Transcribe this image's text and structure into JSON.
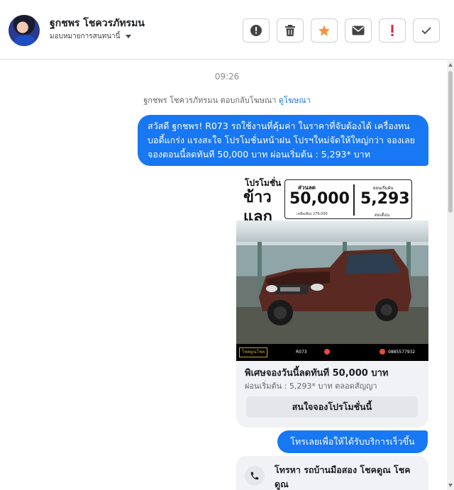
{
  "header": {
    "contact_name": "ฐกชพร โชควรภัทรมน",
    "assign_label": "มอบหมายการสนทนานี้",
    "actions": [
      {
        "name": "spam-button",
        "icon": "exclamation-circle-icon"
      },
      {
        "name": "delete-button",
        "icon": "trash-icon"
      },
      {
        "name": "star-button",
        "icon": "star-icon",
        "color": "#f7923a"
      },
      {
        "name": "mark-unread-button",
        "icon": "envelope-icon"
      },
      {
        "name": "flag-button",
        "icon": "exclamation-icon",
        "color": "#e41e3f"
      },
      {
        "name": "done-button",
        "icon": "check-icon"
      }
    ]
  },
  "conversation": {
    "timestamp": "09:26",
    "replied_notice": "ฐกชพร โชควรภัทรมน ตอบกลับโฆษณา",
    "replied_link": "ดูโฆษณา",
    "message1": "สวัสดี ฐกชพร! R073 รถใช้งานที่คุ้มค่า ในราคาที่จับต้องได้ เครื่องทน บอดี้แกร่ง แรงสะใจ โปรโมชั่นหน้าฝน โปรฯใหม่จัดให้ใหญ่กว่า จองเลย จองตอนนี้ลดทันที 50,000 บาท ผ่อนเริ่มต้น : 5,293* บาท",
    "promo_card": {
      "image": {
        "small_title": "โปรโมชั่น",
        "big_title": "ข้าว แลก ลด",
        "discount_label": "ส่วนลด",
        "discount_value": "50,000",
        "discount_note": "เหลือเพียง 279,000",
        "installment_label": "ผ่อนเริ่มต้น",
        "installment_value": "5,293",
        "installment_note": "ต่อเดือน",
        "footer_logo": "โชคดูณโชค",
        "footer_code": "R073",
        "footer_phone": "0885577932"
      },
      "title": "พิเศษจองวันนี้ลดทันที 50,000 บาท",
      "subtitle": "ผ่อนเริ่มต้น : 5,293* บาท ตลอดสัญญา",
      "button": "สนใจจองโปรโมชั่นนี้"
    },
    "message2": "โทรเลยเพื่อให้ได้รับบริการเร็วขึ้น",
    "call_card": {
      "text": "โทรหา รถบ้านมือสอง โชคดูณ โชคดูณ"
    }
  }
}
